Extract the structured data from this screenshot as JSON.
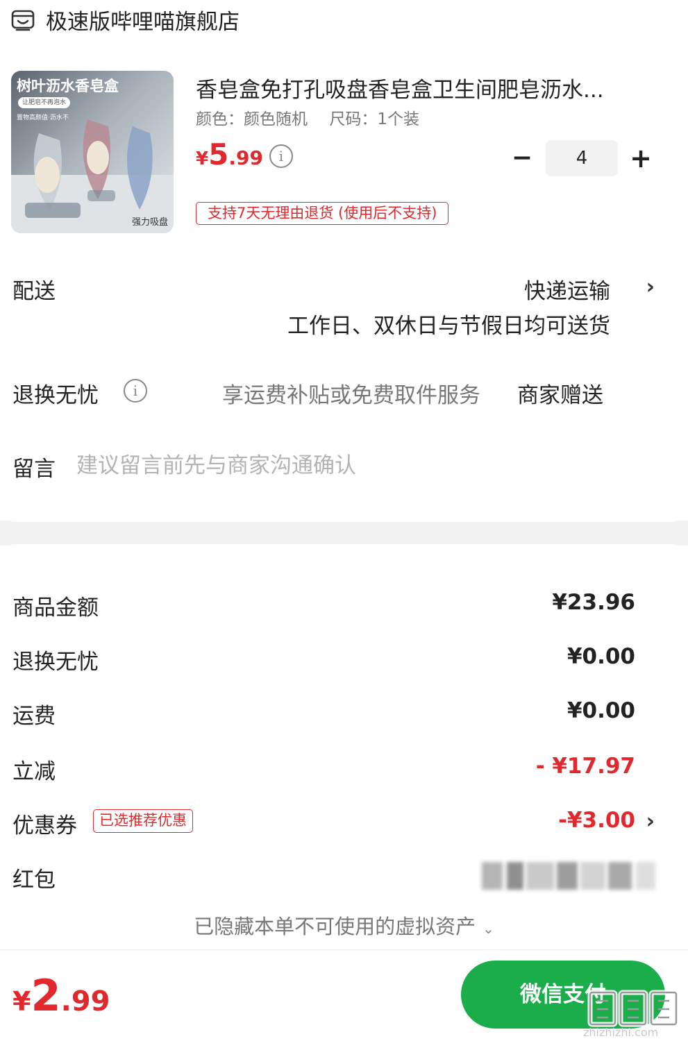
{
  "store": {
    "icon": "store-icon",
    "name": "极速版哔哩喵旗舰店"
  },
  "product": {
    "image": {
      "title": "树叶沥水香皂盒",
      "pill": "让肥皂不再泡水",
      "subtitle": "置物高颜值·沥水不",
      "badge": "强力吸盘"
    },
    "title": "香皂盒免打孔吸盘香皂盒卫生间肥皂沥水...",
    "color_spec": "颜色：颜色随机",
    "size_spec": "尺码：1个装",
    "price": {
      "currency": "¥",
      "integer": "5",
      "decimal": ".99"
    },
    "price_info_icon": "info-icon",
    "quantity": "4",
    "minus_icon": "minus-icon",
    "plus_icon": "plus-icon",
    "return_tag": "支持7天无理由退货 (使用后不支持)"
  },
  "shipping": {
    "label": "配送",
    "method": "快递运输",
    "note": "工作日、双休日与节假日均可送货",
    "chevron": "›"
  },
  "return_service": {
    "label": "退换无忧",
    "info_icon": "info-icon",
    "description": "享运费补贴或免费取件服务",
    "value": "商家赠送"
  },
  "message": {
    "label": "留言",
    "placeholder": "建议留言前先与商家沟通确认",
    "value": ""
  },
  "summary": {
    "goods_amount": {
      "label": "商品金额",
      "value": "¥23.96"
    },
    "return_service": {
      "label": "退换无忧",
      "value": "¥0.00"
    },
    "shipping_fee": {
      "label": "运费",
      "value": "¥0.00"
    },
    "instant_discount": {
      "label": "立减",
      "value": "- ¥17.97"
    },
    "coupon": {
      "label": "优惠券",
      "tag": "已选推荐优惠",
      "value": "-¥3.00",
      "chevron": "›"
    },
    "red_packet": {
      "label": "红包"
    },
    "hidden_assets": {
      "text": "已隐藏本单不可使用的虚拟资产",
      "caret": "⌄"
    }
  },
  "footer": {
    "total": {
      "currency": "¥",
      "integer": "2",
      "decimal": ".99"
    },
    "pay_label": "微信支付"
  },
  "watermark": {
    "url": "zhizhizhi.com"
  },
  "colors": {
    "accent_red": "#e0282d",
    "pay_green": "#1aad4a",
    "muted_text": "#777777",
    "band_gray": "#f2f2f2"
  }
}
